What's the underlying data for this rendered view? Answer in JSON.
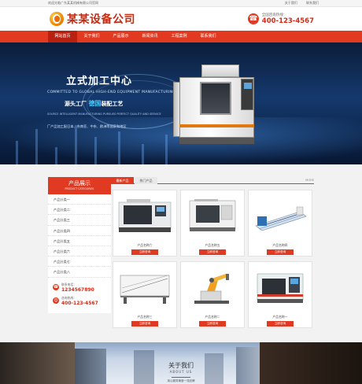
{
  "topbar": {
    "welcome": "欢迎光临广东某某机械有限公司官网",
    "links": [
      "关于我们",
      "联系我们"
    ]
  },
  "header": {
    "company_name": "某某设备公司",
    "hotline_label": "全国咨询热线：",
    "hotline_number": "400-123-4567"
  },
  "nav": {
    "items": [
      "网站首页",
      "关于我们",
      "产品展示",
      "新闻资讯",
      "工程案例",
      "联系我们"
    ],
    "active_index": 0
  },
  "banner": {
    "title": "立式加工中心",
    "subtitle": "COMMITTED TO GLOBAL HIGH-END EQUIPMENT MANUFACTURING",
    "slogan_prefix": "源头工厂",
    "slogan_highlight": "德国",
    "slogan_suffix": "装配工艺",
    "tagline": "SOURCE INTELLIGENT MANUFACTURING PURSUES PERFECT QUALITY AND SERVICE",
    "bottom_tag": "厂产品加工配日本、东南亚、中东、欧洲等国家和地区"
  },
  "hotbar": {
    "label": "热门关键词：",
    "keywords": [
      "产品名称三",
      "产品名称二",
      "产品名称四",
      "产品名称五",
      "产品名称"
    ],
    "search_placeholder": "请输入关键字",
    "search_button": "搜索"
  },
  "sidebar": {
    "title": "产品展示",
    "title_en": "PRODUCT CATEGORIES",
    "items": [
      "产品分类一",
      "产品分类二",
      "产品分类三",
      "产品分类四",
      "产品分类五",
      "产品分类六",
      "产品分类七",
      "产品分类八"
    ],
    "contact": {
      "phone_label": "联系电话：",
      "phone": "1234567890",
      "hotline_label": "咨询热线：",
      "hotline": "400-123-4567"
    }
  },
  "products": {
    "tabs": [
      "最新产品",
      "热门产品"
    ],
    "active_tab": 0,
    "more": "MORE",
    "items": [
      {
        "name": "产品名称六",
        "button": "立即咨询"
      },
      {
        "name": "产品名称五",
        "button": "立即咨询"
      },
      {
        "name": "产品名称四",
        "button": "立即咨询"
      },
      {
        "name": "产品名称三",
        "button": "立即咨询"
      },
      {
        "name": "产品名称二",
        "button": "立即咨询"
      },
      {
        "name": "产品名称一",
        "button": "立即咨询"
      }
    ]
  },
  "about": {
    "title": "关于我们",
    "title_en": "ABOUT US",
    "subtitle": "用心服务铸造一流品牌"
  },
  "colors": {
    "accent": "#e03a22",
    "nav_active": "#b82010",
    "phone_red": "#d62a16"
  }
}
